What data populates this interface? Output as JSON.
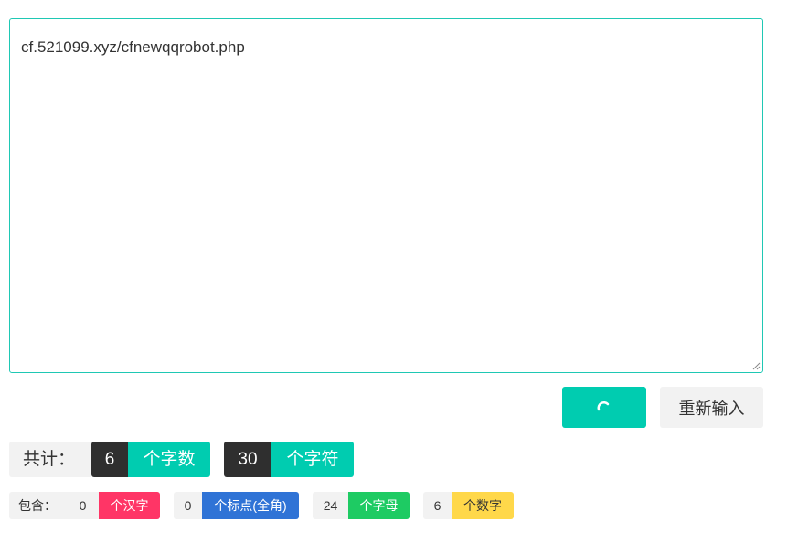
{
  "editor": {
    "value": "cf.521099.xyz/cfnewqqrobot.php"
  },
  "buttons": {
    "submit_icon": "spinner-icon",
    "reset_label": "重新输入"
  },
  "summary": {
    "total_label": "共计：",
    "word_count": "6",
    "word_unit": "个字数",
    "char_count": "30",
    "char_unit": "个字符"
  },
  "breakdown": {
    "label": "包含：",
    "chinese_count": "0",
    "chinese_unit": "个汉字",
    "punct_count": "0",
    "punct_unit": "个标点(全角)",
    "letter_count": "24",
    "letter_unit": "个字母",
    "digit_count": "6",
    "digit_unit": "个数字"
  },
  "colors": {
    "teal": "#00ccb0",
    "dark": "#2f2f2f",
    "pink": "#ff3566",
    "blue": "#2f73d6",
    "green": "#1ecb63",
    "yellow": "#ffd84a"
  }
}
